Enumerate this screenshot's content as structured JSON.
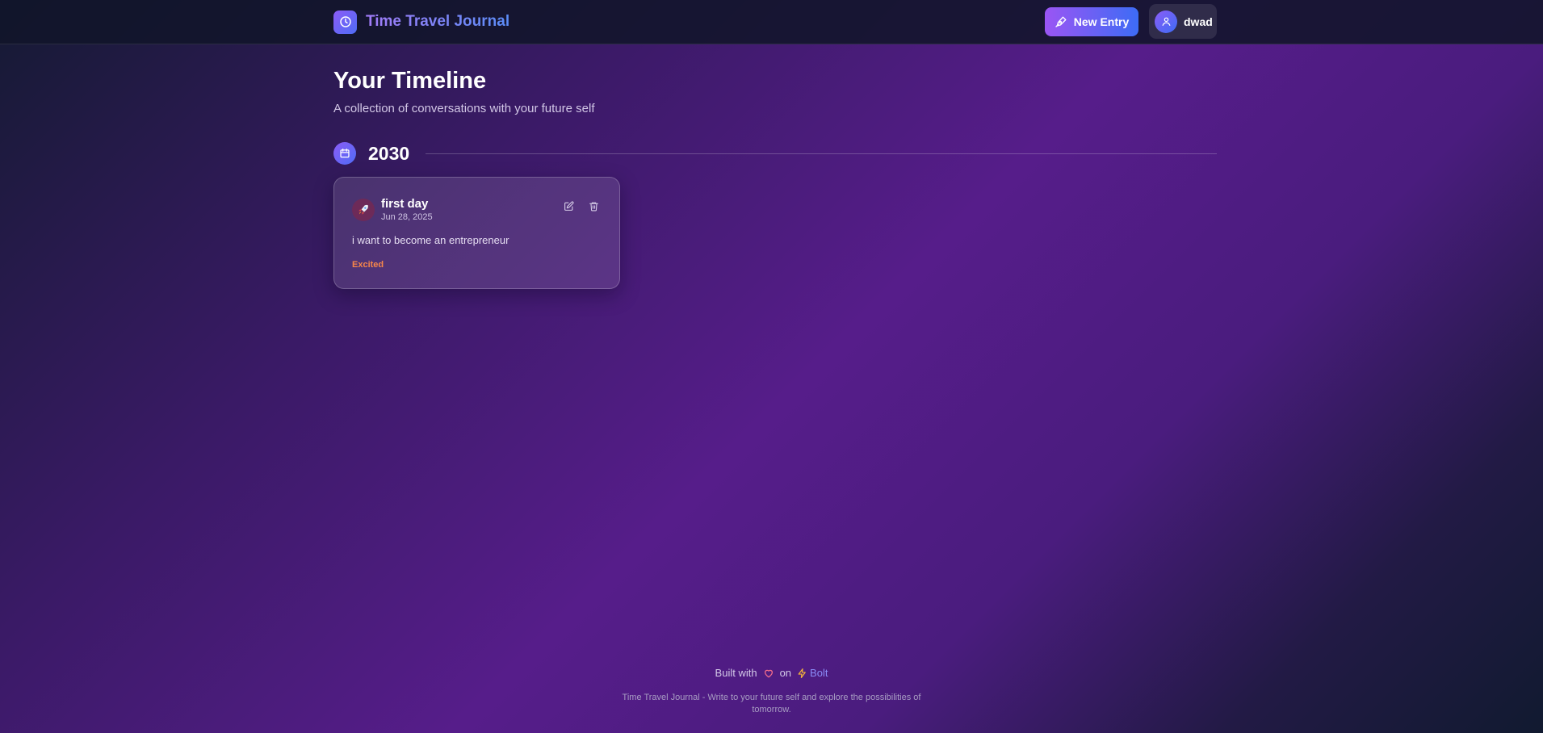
{
  "header": {
    "brand_title": "Time Travel Journal",
    "brand_icon": "clock-icon",
    "new_entry_label": "New Entry",
    "new_entry_icon": "pen-tool-icon",
    "user_name": "dwad",
    "user_icon": "user-icon"
  },
  "main": {
    "title": "Your Timeline",
    "subtitle": "A collection of conversations with your future self",
    "groups": [
      {
        "year": "2030",
        "icon": "calendar-icon",
        "entries": [
          {
            "title": "first day",
            "date": "Jun 28, 2025",
            "body": "i want to become an entrepreneur",
            "mood": "Excited",
            "mood_icon": "rocket-icon",
            "mood_color": "#f7864a"
          }
        ]
      }
    ]
  },
  "footer": {
    "built_with": "Built with",
    "on": "on",
    "bolt": "Bolt",
    "description": "Time Travel Journal - Write to your future self and explore the possibilities of tomorrow."
  },
  "colors": {
    "accent_purple": "#8b5cf6",
    "accent_blue": "#3d6cf5",
    "heart": "#f16b8a",
    "bolt": "#f5b43a"
  }
}
